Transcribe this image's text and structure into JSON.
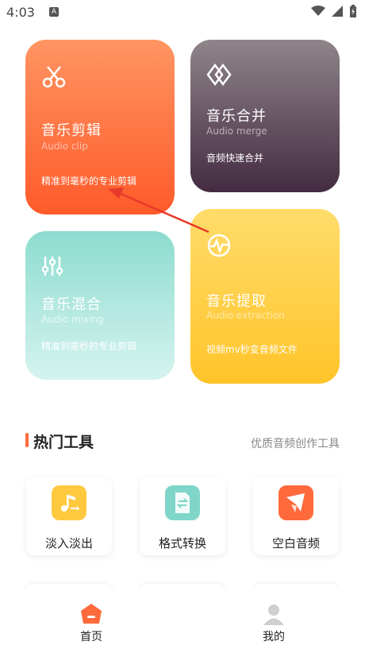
{
  "status": {
    "time": "4:03",
    "notification_badge": "A"
  },
  "cards": {
    "clip": {
      "title": "音乐剪辑",
      "subtitle": "Audio clip",
      "desc": "精准到毫秒的专业剪辑",
      "icon": "scissors-icon"
    },
    "merge": {
      "title": "音乐合并",
      "subtitle": "Audio merge",
      "desc": "音频快速合并",
      "icon": "merge-diamond-icon"
    },
    "mix": {
      "title": "音乐混合",
      "subtitle": "Audio mixing",
      "desc": "精准到毫秒的专业剪辑",
      "icon": "mixer-sliders-icon"
    },
    "extract": {
      "title": "音乐提取",
      "subtitle": "Audio extraction",
      "desc": "视频mv秒变音频文件",
      "icon": "waveform-circle-icon"
    }
  },
  "hot_tools": {
    "title": "热门工具",
    "subtitle": "优质音频创作工具",
    "items": [
      {
        "label": "淡入淡出",
        "icon": "fade-note-icon",
        "color": "#ffc93f"
      },
      {
        "label": "格式转换",
        "icon": "file-convert-icon",
        "color": "#7fd6c8"
      },
      {
        "label": "空白音频",
        "icon": "blank-audio-icon",
        "color": "#ff6a3c"
      }
    ]
  },
  "nav": {
    "home": {
      "label": "首页",
      "icon": "home-icon"
    },
    "mine": {
      "label": "我的",
      "icon": "profile-icon"
    }
  },
  "colors": {
    "accent": "#ff6a3c"
  }
}
